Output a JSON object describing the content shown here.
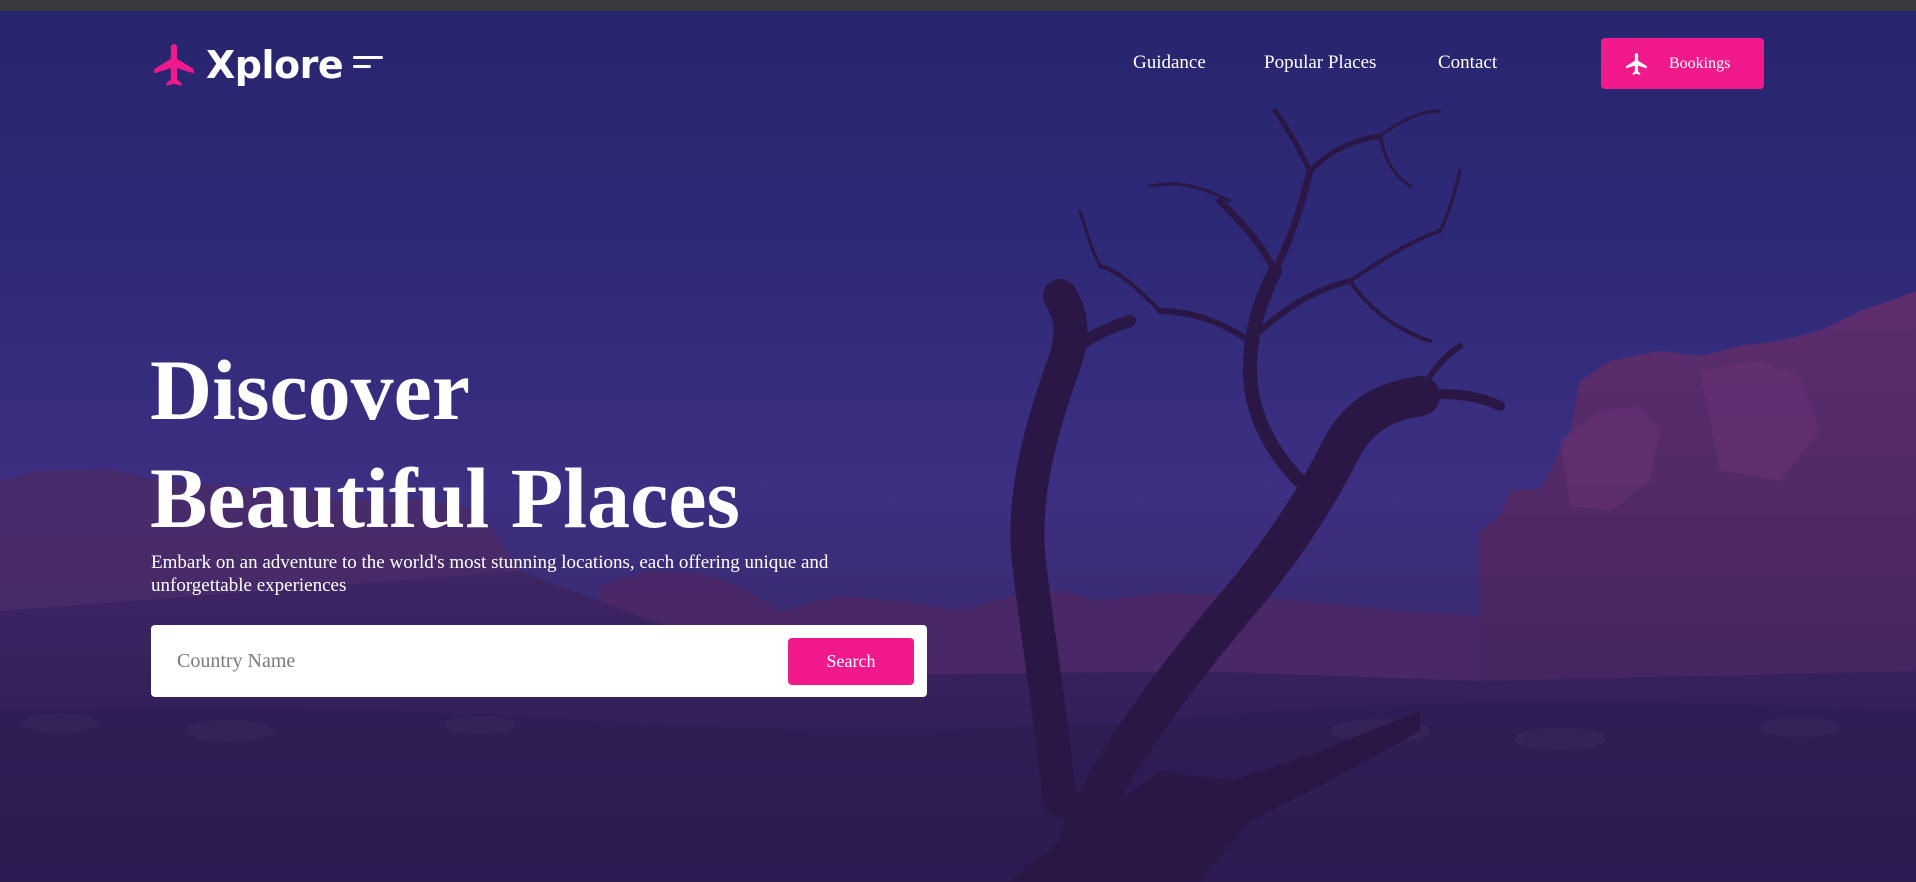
{
  "brand": {
    "name": "Xplore",
    "logo_icon": "airplane-icon",
    "menu_icon": "menu-lines-icon",
    "accent_color": "#f1198c"
  },
  "nav": {
    "links": [
      "Guidance",
      "Popular Places",
      "Contact"
    ],
    "bookings_label": "Bookings",
    "bookings_icon": "airplane-icon"
  },
  "hero": {
    "headline_line1": "Discover",
    "headline_line2": "Beautiful Places",
    "subtitle": "Embark on an adventure to the world's most stunning locations, each offering unique and unforgettable experiences",
    "background_overlay": "#2f2a78"
  },
  "search": {
    "placeholder": "Country Name",
    "value": "",
    "button_label": "Search"
  }
}
